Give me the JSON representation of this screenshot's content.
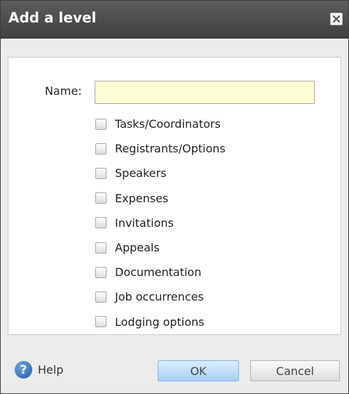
{
  "dialog": {
    "title": "Add a level",
    "close_icon": "close-icon"
  },
  "form": {
    "name_label": "Name:",
    "name_value": "",
    "name_placeholder": "",
    "options": [
      {
        "label": "Tasks/Coordinators",
        "checked": false
      },
      {
        "label": "Registrants/Options",
        "checked": false
      },
      {
        "label": "Speakers",
        "checked": false
      },
      {
        "label": "Expenses",
        "checked": false
      },
      {
        "label": "Invitations",
        "checked": false
      },
      {
        "label": "Appeals",
        "checked": false
      },
      {
        "label": "Documentation",
        "checked": false
      },
      {
        "label": "Job occurrences",
        "checked": false
      },
      {
        "label": "Lodging options",
        "checked": false
      }
    ]
  },
  "footer": {
    "help_icon": "help-icon",
    "help_label": "Help",
    "ok_label": "OK",
    "cancel_label": "Cancel"
  },
  "colors": {
    "titlebar": "#4a4a4a",
    "input_background": "#ffffd6",
    "ok_button": "#a9d0f5"
  }
}
